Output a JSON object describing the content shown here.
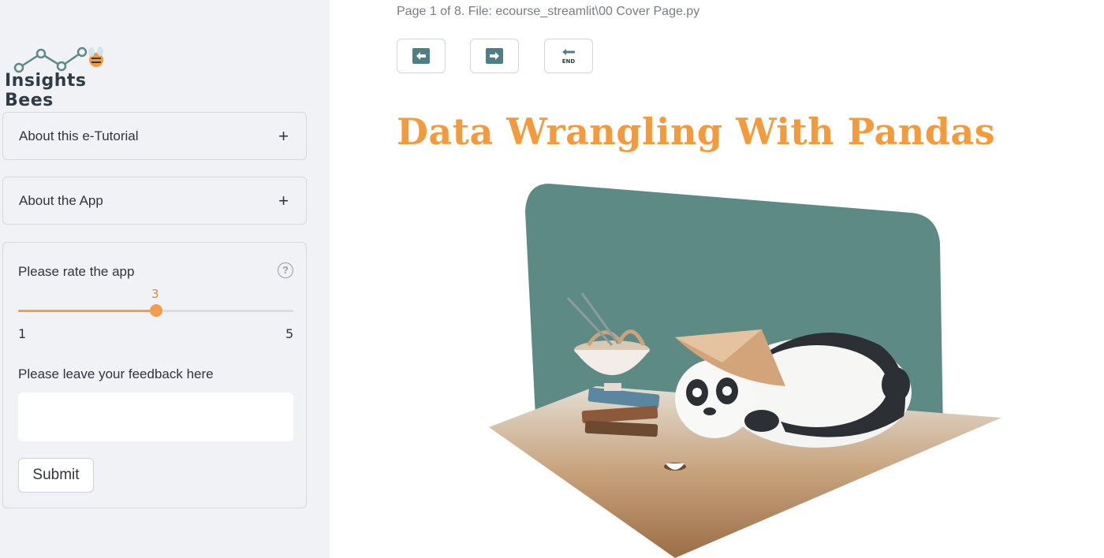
{
  "sidebar": {
    "logo_text": "Insights Bees",
    "expanders": [
      {
        "label": "About this e-Tutorial",
        "icon": "plus-icon"
      },
      {
        "label": "About the App",
        "icon": "plus-icon"
      }
    ],
    "form": {
      "rate_label": "Please rate the app",
      "help_icon": "question-circle-icon",
      "slider": {
        "value": "3",
        "min": "1",
        "max": "5",
        "fraction": 0.5
      },
      "feedback_label": "Please leave your feedback here",
      "feedback_value": "",
      "submit_label": "Submit"
    }
  },
  "main": {
    "page_info": "Page 1 of 8. File: ecourse_streamlit\\00 Cover Page.py",
    "nav_buttons": [
      {
        "icon": "arrow-left-icon"
      },
      {
        "icon": "arrow-right-icon"
      },
      {
        "icon": "end-arrow-icon",
        "text": "END"
      }
    ],
    "title": "Data Wrangling With Pandas",
    "illustration": "panda-illustration"
  },
  "colors": {
    "accent": "#f39c4b",
    "title": "#f39a3c",
    "sidebar_bg": "#f0f2f6",
    "nav_icon": "#4f7f86",
    "illustration_teal": "#5e8a86"
  }
}
